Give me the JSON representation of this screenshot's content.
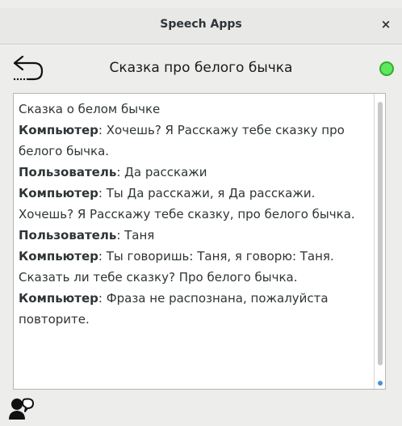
{
  "window": {
    "title": "Speech Apps",
    "close_label": "×"
  },
  "header": {
    "back_icon": "back-arrow-icon",
    "title": "Сказка про белого бычка",
    "status_color": "#5ee85e"
  },
  "conversation": [
    {
      "speaker": "",
      "sep": "",
      "text": "Сказка о белом бычке"
    },
    {
      "speaker": "Компьютер",
      "sep": ":",
      "text": " Хочешь? Я Расскажу тебе сказку про белого бычка."
    },
    {
      "speaker": "Пользователь",
      "sep": ":",
      "text": " Да расскажи"
    },
    {
      "speaker": "Компьютер",
      "sep": ":",
      "text": " Ты Да расскажи, я Да расскажи. Хочешь? Я Расскажу тебе сказку, про белого бычка."
    },
    {
      "speaker": "Пользователь",
      "sep": ":",
      "text": " Таня"
    },
    {
      "speaker": "Компьютер",
      "sep": ":",
      "text": " Ты говоришь: Таня, я говорю: Таня. Сказать ли тебе сказку? Про белого бычка."
    },
    {
      "speaker": "Компьютер",
      "sep": ":",
      "text": " Фраза не распознана, пожалуйста повторите."
    }
  ],
  "footer": {
    "speak_icon": "speaking-person-icon"
  }
}
